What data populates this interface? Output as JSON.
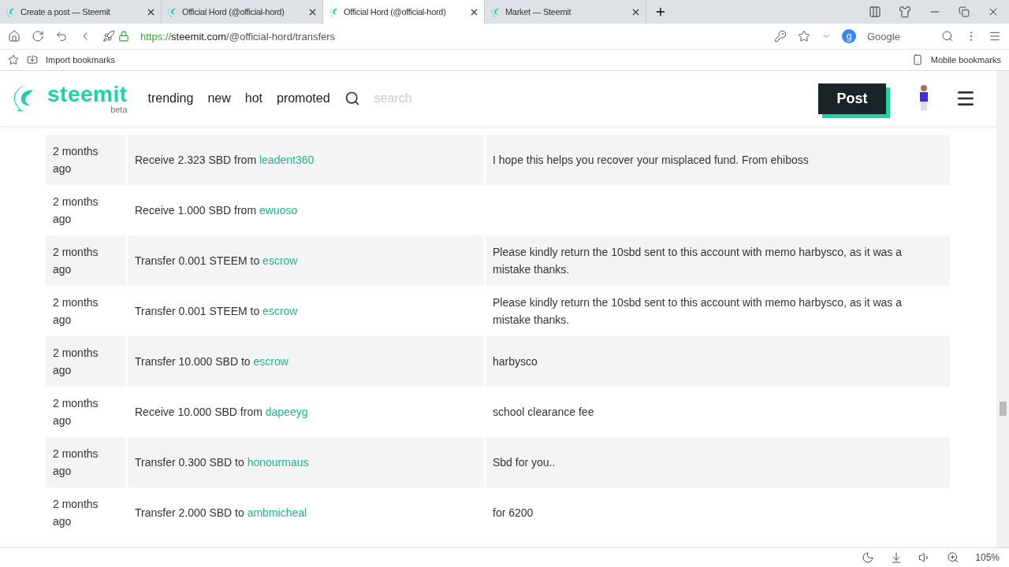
{
  "browser": {
    "tabs": [
      {
        "title": "Create a post — Steemit",
        "selected": false
      },
      {
        "title": "Official Hord (@official-hord)",
        "selected": false
      },
      {
        "title": "Official Hord (@official-hord)",
        "selected": true
      },
      {
        "title": "Market — Steemit",
        "selected": false
      }
    ],
    "url_scheme": "https://",
    "url_host": "steemit.com",
    "url_path": "/@official-hord/transfers",
    "search_engine_badge": "g",
    "search_engine": "Google",
    "bookmarks": [
      "Import bookmarks"
    ],
    "mobile_bookmarks": "Mobile bookmarks",
    "zoom": "105%"
  },
  "header": {
    "logo": "steemit",
    "logo_sub": "beta",
    "nav": [
      "trending",
      "new",
      "hot",
      "promoted"
    ],
    "search": {
      "placeholder": "search"
    },
    "post_button": "Post"
  },
  "transfers": [
    {
      "time": "2 months ago",
      "action": "Receive 2.323 SBD from",
      "account": "leadent360",
      "memo": "I hope this helps you recover your misplaced fund. From ehiboss"
    },
    {
      "time": "2 months ago",
      "action": "Receive 1.000 SBD from",
      "account": "ewuoso"
    },
    {
      "time": "2 months ago",
      "action": "Transfer 0.001 STEEM to",
      "account": "escrow",
      "memo": "Please kindly return the 10sbd sent to this account with memo harbysco, as it was a mistake thanks."
    },
    {
      "time": "2 months ago",
      "action": "Transfer 0.001 STEEM to",
      "account": "escrow",
      "memo": "Please kindly return the 10sbd sent to this account with memo harbysco, as it was a mistake thanks."
    },
    {
      "time": "2 months ago",
      "action": "Transfer 10.000 SBD to",
      "account": "escrow",
      "memo": "harbysco"
    },
    {
      "time": "2 months ago",
      "action": "Receive 10.000 SBD from",
      "account": "dapeeyg",
      "memo": "school clearance fee"
    },
    {
      "time": "2 months ago",
      "action": "Transfer 0.300 SBD to",
      "account": "honourmaus",
      "memo": "Sbd for you.."
    },
    {
      "time": "2 months ago",
      "action": "Transfer 2.000 SBD to",
      "account": "ambmicheal",
      "memo": "for 6200"
    }
  ]
}
